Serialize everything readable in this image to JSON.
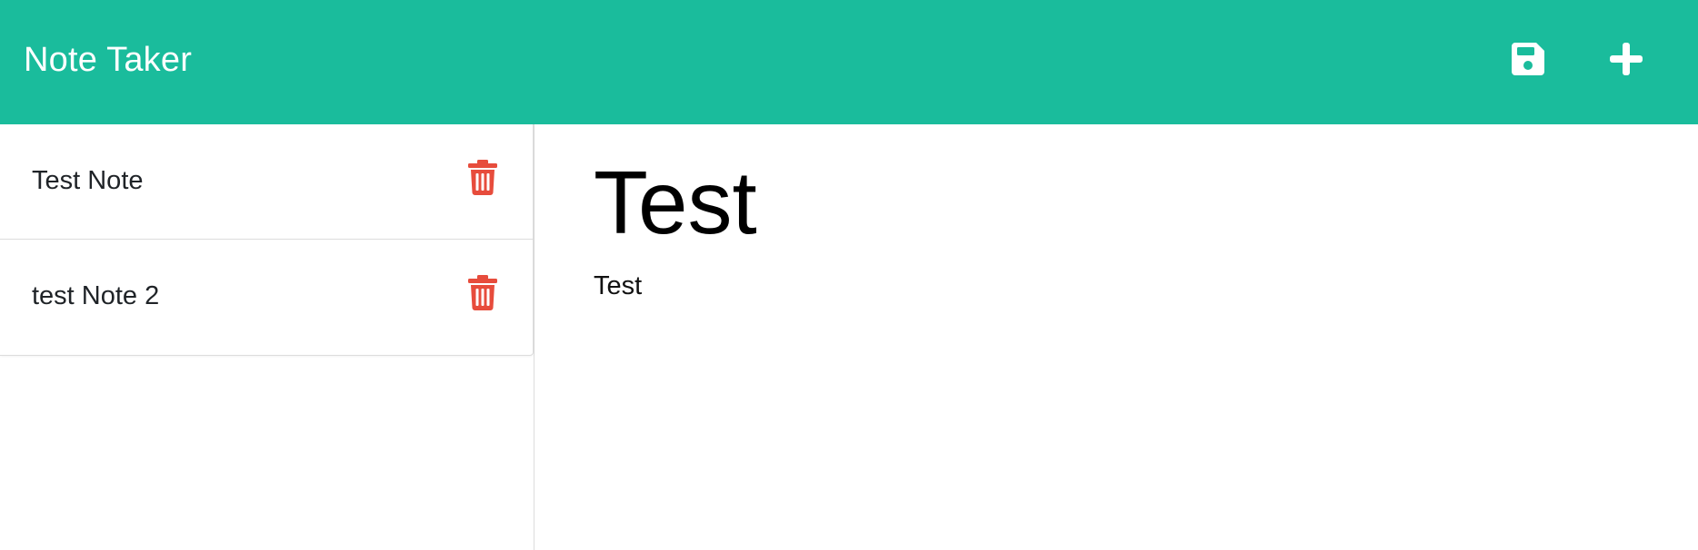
{
  "navbar": {
    "brand": "Note Taker",
    "save_icon": "save-icon",
    "add_icon": "plus-icon",
    "bg_color": "#1abc9c"
  },
  "sidebar": {
    "notes": [
      {
        "title": "Test Note",
        "delete_icon": "trash-icon"
      },
      {
        "title": "test Note 2",
        "delete_icon": "trash-icon"
      }
    ],
    "delete_color": "#e74c3c"
  },
  "editor": {
    "title": "Test",
    "body": "Test"
  }
}
